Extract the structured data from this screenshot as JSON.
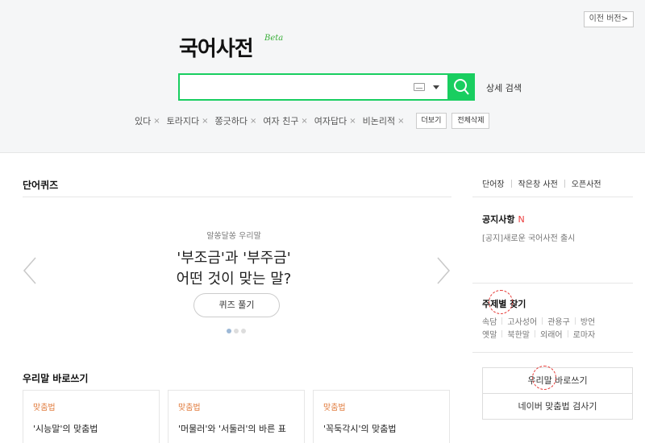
{
  "header": {
    "prev_version": "이전 버전",
    "prev_version_arrow": ">",
    "logo": "국어사전",
    "beta": "Beta"
  },
  "search": {
    "value": "",
    "placeholder": "",
    "detail": "상세 검색",
    "icons": [
      "keyboard-icon",
      "caret-down-icon",
      "search-icon"
    ]
  },
  "recent": {
    "items": [
      "있다",
      "토라지다",
      "쫑긋하다",
      "여자 친구",
      "여자답다",
      "비논리적"
    ],
    "remove_glyph": "×",
    "more": "더보기",
    "delete_all": "전체삭제"
  },
  "quiz": {
    "section_title": "단어퀴즈",
    "subtitle": "알쏭달쏭 우리말",
    "question_line1": "'부조금'과 '부주금'",
    "question_line2": "어떤 것이 맞는 말?",
    "button": "퀴즈 풀기",
    "dots_total": 3,
    "dots_active": 1
  },
  "spelling": {
    "section_title": "우리말 바로쓰기",
    "cards": [
      {
        "category": "맞춤법",
        "title": "'시능말'의 맞춤법"
      },
      {
        "category": "맞춤법",
        "title": "'머물러'와 '서둘러'의 바른 표"
      },
      {
        "category": "맞춤법",
        "title": "'꼭둑각시'의 맞춤법"
      }
    ]
  },
  "sidebar": {
    "links": [
      "단어장",
      "작은창 사전",
      "오픈사전"
    ],
    "notice_title": "공지사항",
    "notice_new": "N",
    "notice_item": "[공지]새로운 국어사전 출시",
    "topic_title": "주제별 찾기",
    "topics_row1": [
      "속담",
      "고사성어",
      "관용구",
      "방언"
    ],
    "topics_row2": [
      "옛말",
      "북한말",
      "외래어",
      "로마자"
    ],
    "box1": "우리말 바로쓰기",
    "box2": "네이버 맞춤법 검사기"
  },
  "colors": {
    "accent_green": "#19ce60",
    "category_orange": "#e0793a",
    "new_red": "#ec3c3c"
  }
}
